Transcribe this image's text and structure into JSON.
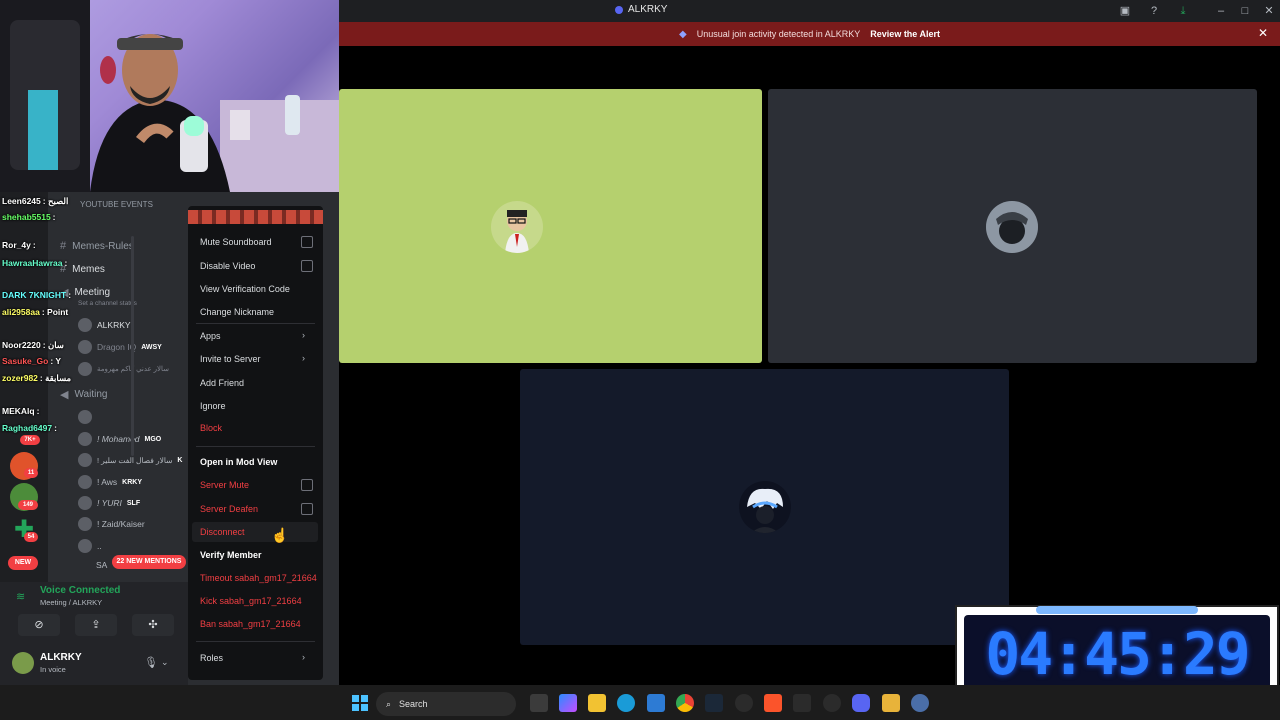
{
  "titlebar": {
    "title": "ALKRKY"
  },
  "alert": {
    "message": "Unusual join activity detected in ALKRKY",
    "action": "Review the Alert"
  },
  "youtube_events": "YOUTUBE EVENTS",
  "chat": [
    {
      "user": "Leen6245",
      "msg": ": الصبح",
      "color": "#ffffff"
    },
    {
      "user": "shehab5515",
      "msg": ":",
      "color": "#66ff66"
    },
    {
      "user": "Ror_4y",
      "msg": ":",
      "color": "#ffffff"
    },
    {
      "user": "HawraaHawraa",
      "msg": ":",
      "color": "#66ffcc"
    },
    {
      "user": "DARK 7KNIGHT",
      "msg": ":",
      "color": "#66ffff"
    },
    {
      "user": "ali2958aa",
      "msg": ": Point",
      "color": "#ffff66"
    },
    {
      "user": "Noor2220",
      "msg": ": سان",
      "color": "#ffffff"
    },
    {
      "user": "Sasuke_Go",
      "msg": ": Y",
      "color": "#ff5555"
    },
    {
      "user": "zozer982",
      "msg": ": مسابقة",
      "color": "#ffff66"
    },
    {
      "user": "MEKAlq",
      "msg": ":",
      "color": "#ffffff"
    },
    {
      "user": "Raghad6497",
      "msg": ":",
      "color": "#66ffcc"
    }
  ],
  "channels": [
    {
      "name": "Memes-Rules"
    },
    {
      "name": "Memes"
    },
    {
      "name": "Meeting"
    },
    {
      "name": "Waiting"
    }
  ],
  "channel_status_hint": "Set a channel status",
  "members_meeting": [
    {
      "name": "ALKRKY",
      "tag": ""
    },
    {
      "name": "Dragon IQ",
      "tag": "AWSY"
    },
    {
      "name": "سالار عدني كاكم مهرومة",
      "tag": ""
    }
  ],
  "members_waiting": [
    {
      "name": "! Mohamed",
      "tag": "MGO"
    },
    {
      "name": "! سالار فصال الفت سلير",
      "tag": "K"
    },
    {
      "name": "! Aws",
      "tag": "KRKY"
    },
    {
      "name": "! YURI",
      "tag": "SLF"
    },
    {
      "name": "! Zaid/Kaiser",
      "tag": ""
    },
    {
      "name": "..",
      "tag": ""
    },
    {
      "name": "SA",
      "tag": ""
    }
  ],
  "badges": {
    "new": "NEW",
    "mentions": "22 NEW MENTIONS",
    "b1": "7K+",
    "b2": "11",
    "b3": "149",
    "b4": "54"
  },
  "context_menu": {
    "mute_soundboard": "Mute Soundboard",
    "disable_video": "Disable Video",
    "view_verification": "View Verification Code",
    "change_nickname": "Change Nickname",
    "apps": "Apps",
    "invite": "Invite to Server",
    "add_friend": "Add Friend",
    "ignore": "Ignore",
    "block": "Block",
    "mod_view": "Open in Mod View",
    "server_mute": "Server Mute",
    "server_deafen": "Server Deafen",
    "disconnect": "Disconnect",
    "verify": "Verify Member",
    "timeout": "Timeout sabah_gm17_21664",
    "kick": "Kick sabah_gm17_21664",
    "ban": "Ban sabah_gm17_21664",
    "roles": "Roles"
  },
  "voice": {
    "status": "Voice Connected",
    "location": "Meeting / ALKRKY"
  },
  "user": {
    "name": "ALKRKY",
    "status": "In voice"
  },
  "taskbar": {
    "search": "Search"
  },
  "timer": "04:45:29"
}
